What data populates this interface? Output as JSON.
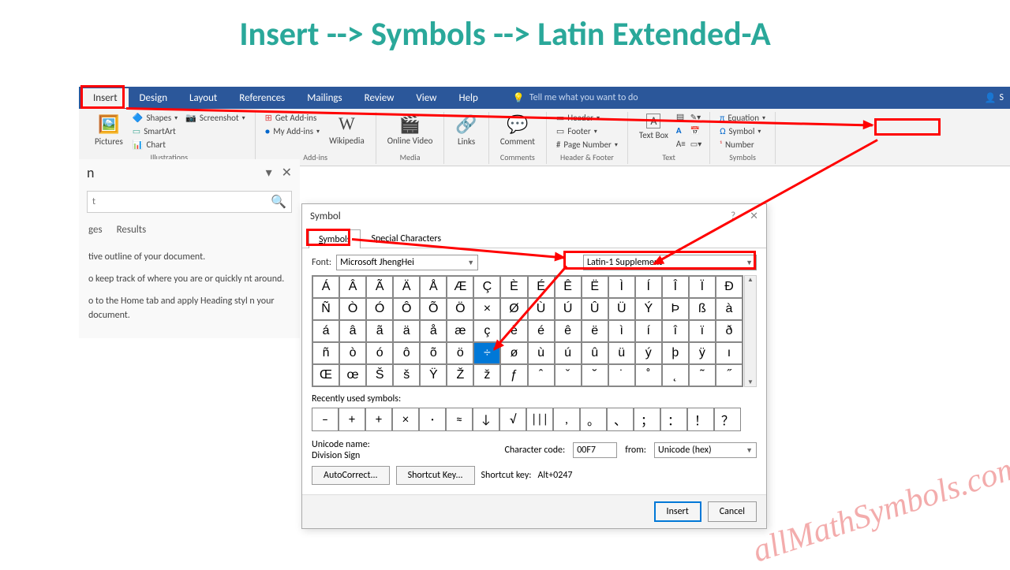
{
  "banner": "Insert --> Symbols --> Latin Extended-A",
  "ribbon": {
    "tabs": [
      "Insert",
      "Design",
      "Layout",
      "References",
      "Mailings",
      "Review",
      "View",
      "Help"
    ],
    "tell_me": "Tell me what you want to do",
    "user": "S",
    "groups": {
      "illustrations": {
        "label": "Illustrations",
        "pictures": "Pictures",
        "shapes": "Shapes",
        "smartart": "SmartArt",
        "chart": "Chart",
        "screenshot": "Screenshot"
      },
      "addins": {
        "label": "Add-ins",
        "get": "Get Add-ins",
        "my": "My Add-ins",
        "wiki": "Wikipedia"
      },
      "media": {
        "label": "Media",
        "video": "Online Video"
      },
      "links": {
        "label": "",
        "links": "Links"
      },
      "comments": {
        "label": "Comments",
        "comment": "Comment"
      },
      "headerfooter": {
        "label": "Header & Footer",
        "header": "Header",
        "footer": "Footer",
        "page": "Page Number"
      },
      "text": {
        "label": "Text",
        "textbox": "Text Box"
      },
      "symbols": {
        "label": "Symbols",
        "equation": "Equation",
        "symbol": "Symbol",
        "number": "Number"
      }
    }
  },
  "nav": {
    "title": "n",
    "search_placeholder": "t",
    "tabs": [
      "ges",
      "Results"
    ],
    "body": [
      "tive outline of your document.",
      "o keep track of where you are or quickly nt around.",
      "o to the Home tab and apply Heading styl n your document."
    ]
  },
  "dialog": {
    "title": "Symbol",
    "tabs": {
      "symbols": "Symbols",
      "special": "Special Characters"
    },
    "font_label": "Font:",
    "font_value": "Microsoft JhengHei",
    "subset_value": "Latin-1 Supplement",
    "grid": [
      [
        "Á",
        "Â",
        "Ã",
        "Ä",
        "Å",
        "Æ",
        "Ç",
        "È",
        "É",
        "Ê",
        "Ë",
        "Ì",
        "Í",
        "Î",
        "Ï",
        "Ð"
      ],
      [
        "Ñ",
        "Ò",
        "Ó",
        "Ô",
        "Õ",
        "Ö",
        "×",
        "Ø",
        "Ù",
        "Ú",
        "Û",
        "Ü",
        "Ý",
        "Þ",
        "ß",
        "à"
      ],
      [
        "á",
        "â",
        "ã",
        "ä",
        "å",
        "æ",
        "ç",
        "è",
        "é",
        "ê",
        "ë",
        "ì",
        "í",
        "î",
        "ï",
        "ð"
      ],
      [
        "ñ",
        "ò",
        "ó",
        "ô",
        "õ",
        "ö",
        "÷",
        "ø",
        "ù",
        "ú",
        "û",
        "ü",
        "ý",
        "þ",
        "ÿ",
        "ı"
      ],
      [
        "Œ",
        "œ",
        "Š",
        "š",
        "Ÿ",
        "Ž",
        "ž",
        "ƒ",
        "ˆ",
        "ˇ",
        "˘",
        "˙",
        "˚",
        "˛",
        "˜",
        "˝"
      ]
    ],
    "selected_row": 3,
    "selected_col": 6,
    "recent_label": "Recently used symbols:",
    "recent": [
      "–",
      "+",
      "+",
      "×",
      "·",
      "≈",
      "↓",
      "√",
      "|||",
      ",",
      "。",
      "、",
      "；",
      "：",
      "！",
      "？"
    ],
    "unicode_name_label": "Unicode name:",
    "unicode_name": "Division Sign",
    "charcode_label": "Character code:",
    "charcode_value": "00F7",
    "from_label": "from:",
    "from_value": "Unicode (hex)",
    "autocorrect": "AutoCorrect...",
    "shortcut": "Shortcut Key...",
    "shortcut_info_label": "Shortcut key:",
    "shortcut_info": "Alt+0247",
    "insert": "Insert",
    "cancel": "Cancel"
  },
  "watermark": "allMathSymbols.com"
}
